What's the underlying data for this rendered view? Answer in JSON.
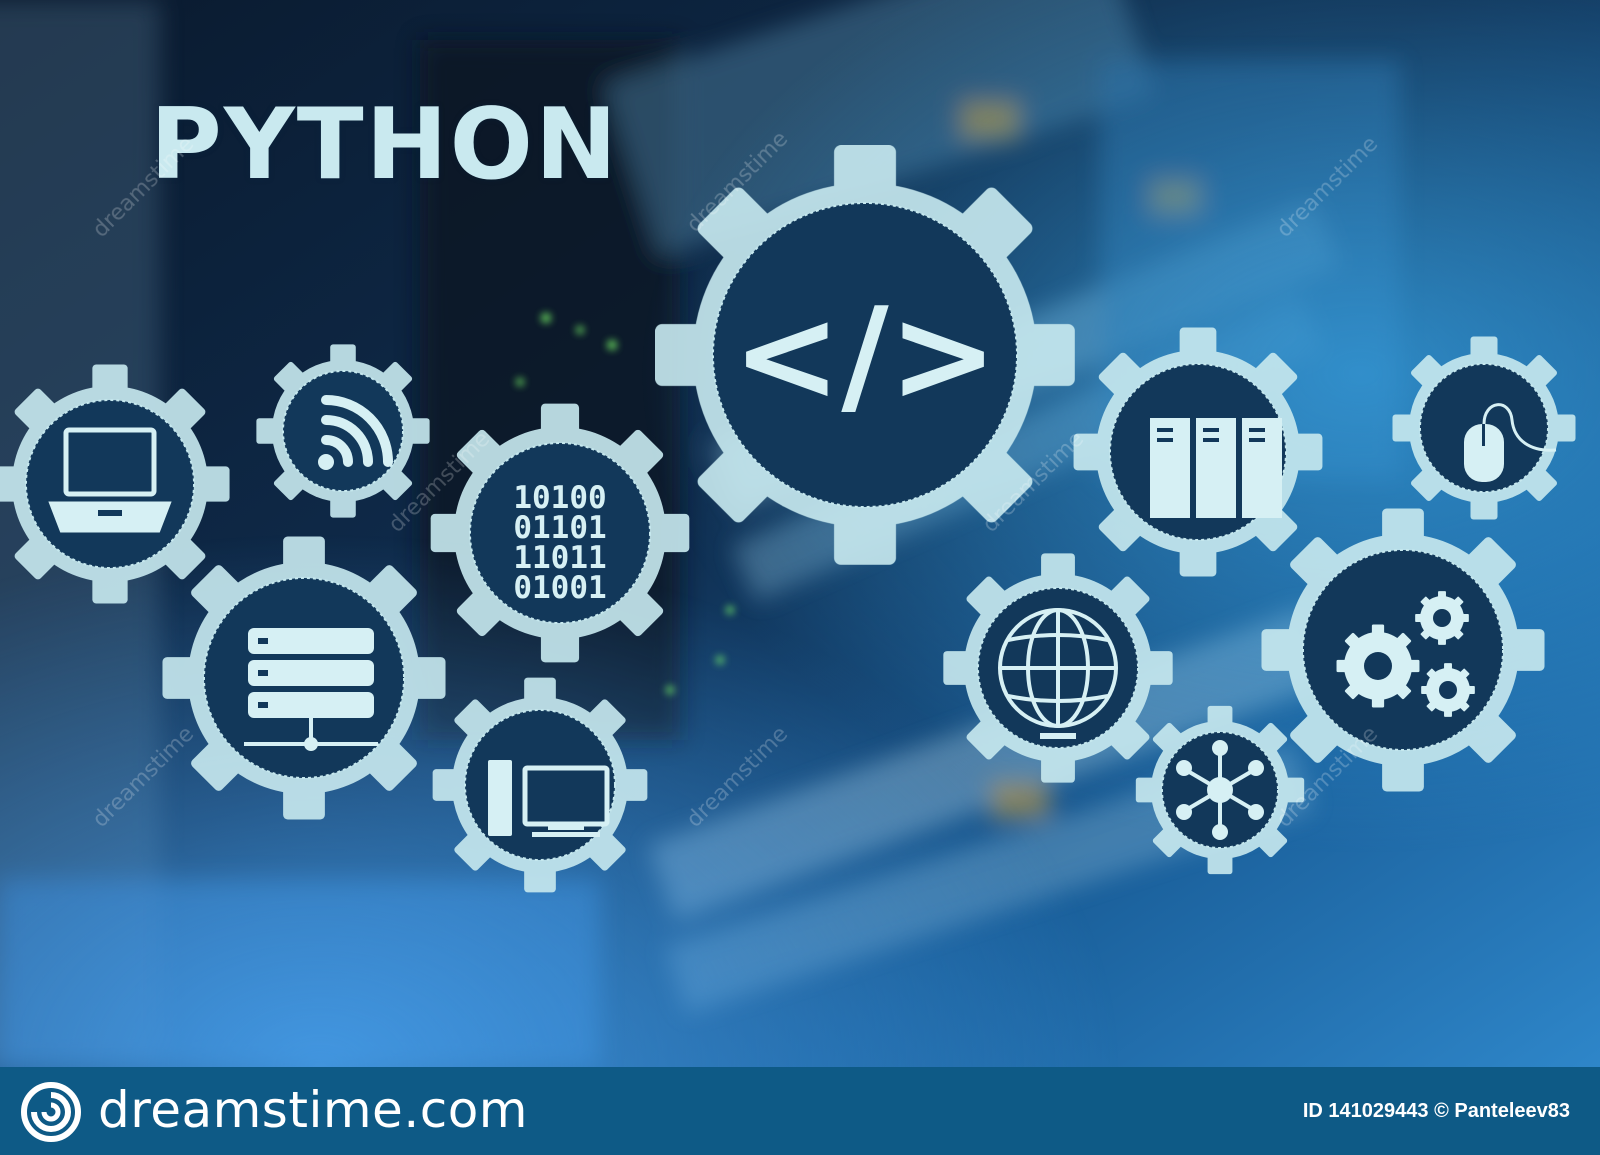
{
  "headline": "PYTHON",
  "code_symbol": "</>",
  "binary_lines": [
    "10100",
    "01101",
    "11011",
    "01001"
  ],
  "watermark_text": "dreamstime",
  "footer": {
    "brand": "dreamstime.com",
    "image_id": "ID 141029443",
    "author": "© Panteleev83",
    "credit": "ID 141029443 © Panteleev83"
  },
  "colors": {
    "gear_fill": "#c6e8ee",
    "gear_inner": "#12385a",
    "icon": "#d6f0f4",
    "footer_bg": "#0e5a86"
  },
  "icons": [
    "laptop-icon",
    "wifi-icon",
    "binary-code-icon",
    "code-tag-icon",
    "servers-icon",
    "mouse-icon",
    "database-server-icon",
    "desktop-computer-icon",
    "globe-icon",
    "network-nodes-icon",
    "settings-gears-icon"
  ]
}
